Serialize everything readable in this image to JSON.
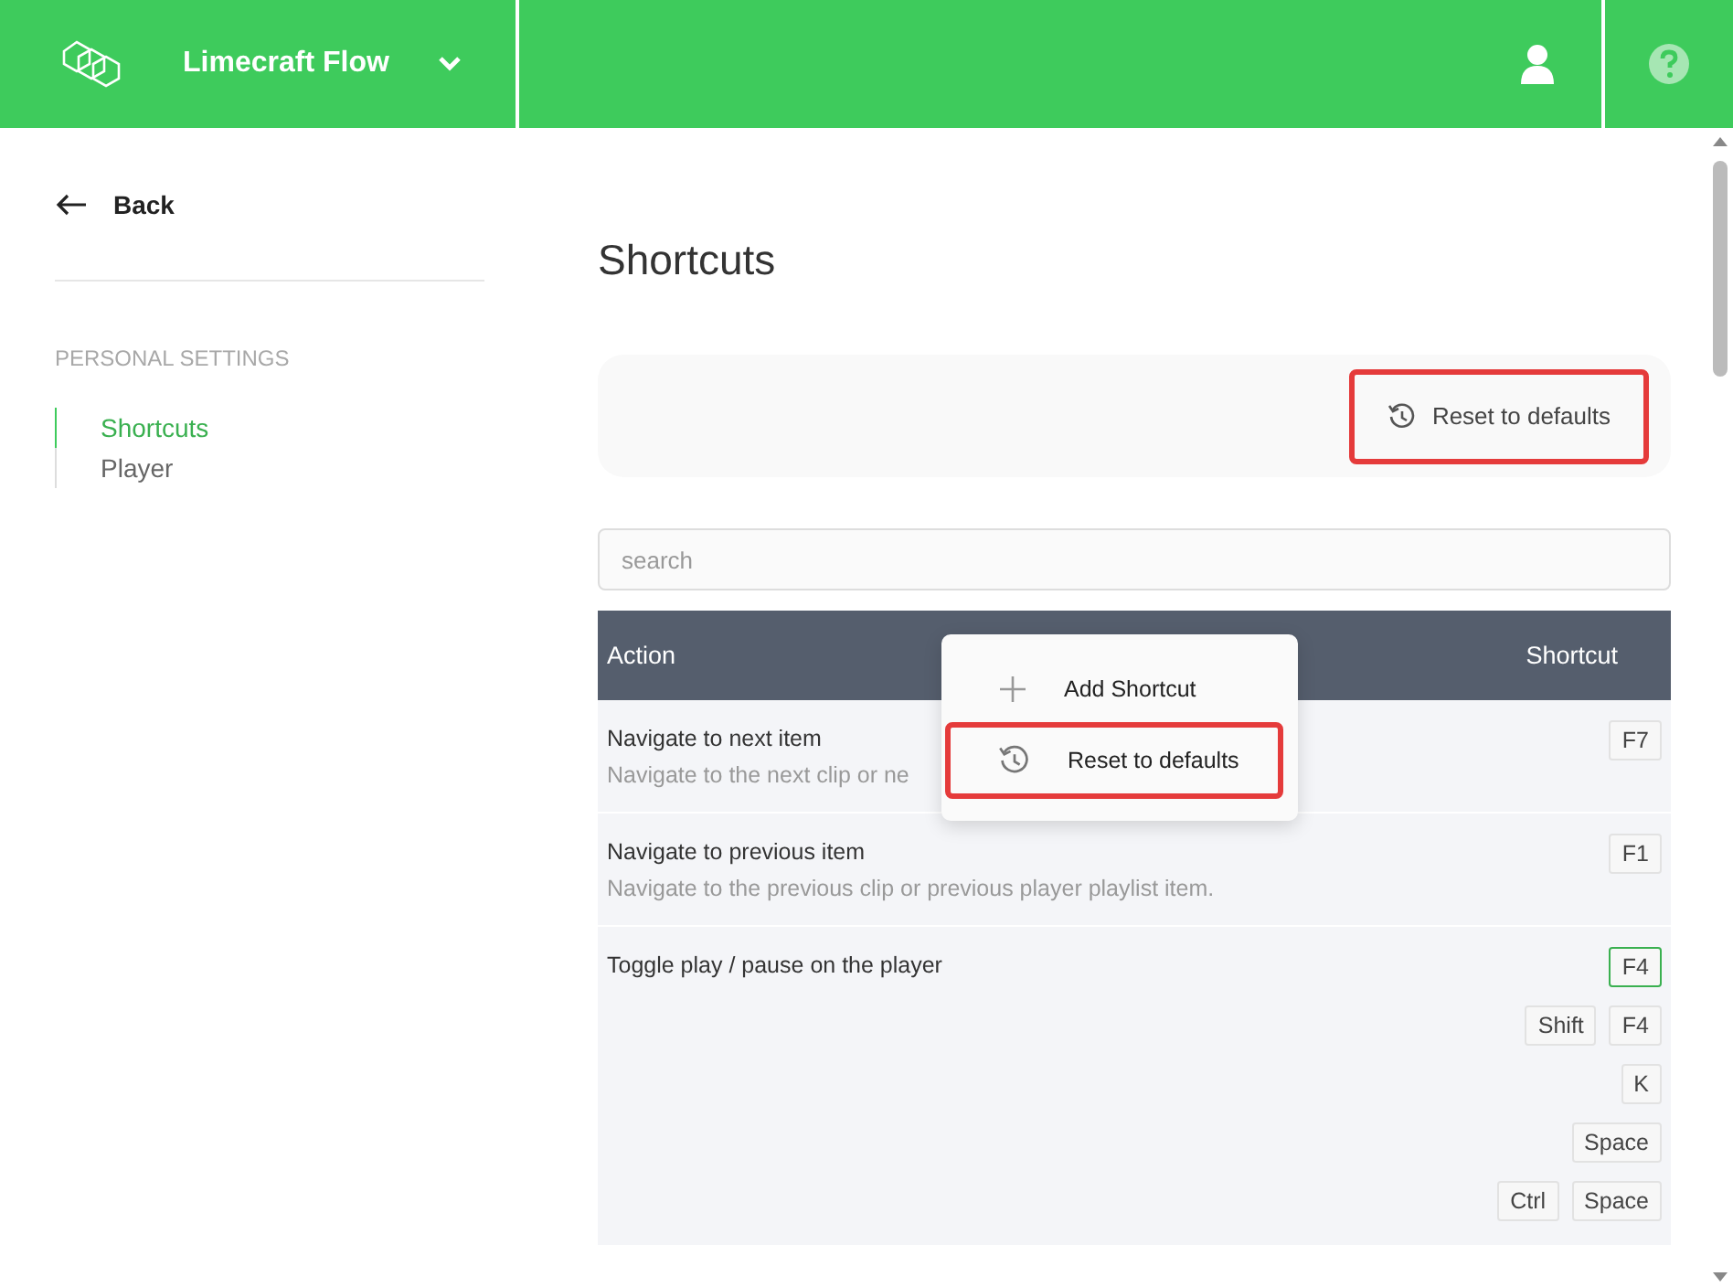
{
  "header": {
    "app_name": "Limecraft Flow"
  },
  "sidebar": {
    "back_label": "Back",
    "section_title": "PERSONAL SETTINGS",
    "items": [
      {
        "label": "Shortcuts",
        "selected": true
      },
      {
        "label": "Player",
        "selected": false
      }
    ]
  },
  "page_title": "Shortcuts",
  "toolbar": {
    "reset_button": {
      "label": "Reset to defaults",
      "highlighted": true
    }
  },
  "search": {
    "placeholder": "search"
  },
  "table": {
    "columns": [
      "Action",
      "Shortcut"
    ],
    "rows": [
      {
        "action": "Navigate to next item",
        "description": "Navigate to the next clip or ne",
        "shortcuts": [
          {
            "keys": [
              "F7"
            ],
            "highlighted": false
          }
        ]
      },
      {
        "action": "Navigate to previous item",
        "description": "Navigate to the previous clip or previous player playlist item.",
        "shortcuts": [
          {
            "keys": [
              "F1"
            ],
            "highlighted": false
          }
        ]
      },
      {
        "action": "Toggle play / pause on the player",
        "shortcuts": [
          {
            "keys": [
              "F4"
            ],
            "highlighted": true
          },
          {
            "keys": [
              "Shift",
              "F4"
            ],
            "highlighted": false
          },
          {
            "keys": [
              "K"
            ],
            "highlighted": false
          },
          {
            "keys": [
              "Space"
            ],
            "highlighted": false
          },
          {
            "keys": [
              "Ctrl",
              "Space"
            ],
            "highlighted": false
          }
        ]
      }
    ]
  },
  "context_menu": {
    "items": [
      {
        "kind": "add",
        "label": "Add Shortcut",
        "highlighted": false
      },
      {
        "kind": "reset",
        "label": "Reset to defaults",
        "highlighted": true
      }
    ]
  }
}
